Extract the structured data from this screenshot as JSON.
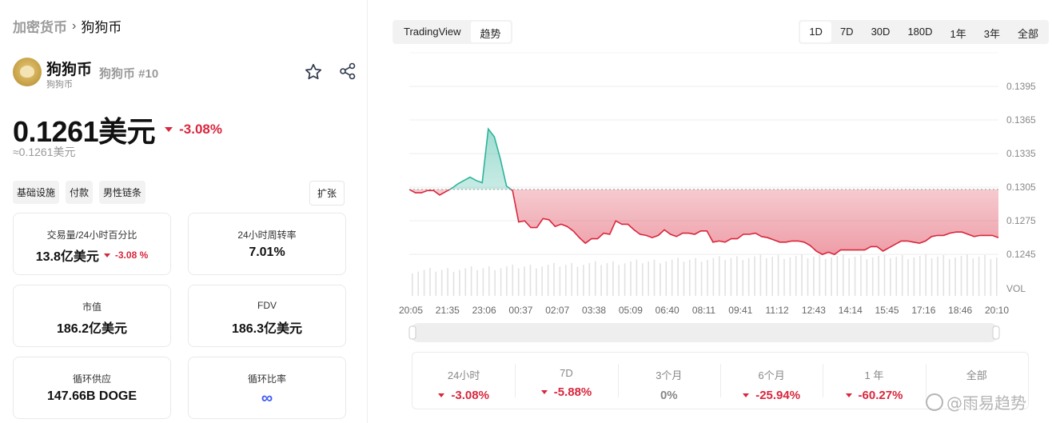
{
  "breadcrumb": {
    "parent": "加密货币",
    "current": "狗狗币"
  },
  "coin": {
    "name": "狗狗币",
    "subname": "狗狗币",
    "rank": "狗狗币 #10"
  },
  "price": {
    "value": "0.1261美元",
    "change": "-3.08%",
    "approx": "≈0.1261美元"
  },
  "tags": [
    "基础设施",
    "付款",
    "男性链条"
  ],
  "expand_label": "扩张",
  "stats": [
    {
      "label": "交易量/24小时百分比",
      "value": "13.8亿美元",
      "sub": "-3.08 %"
    },
    {
      "label": "24小时周转率",
      "value": "7.01%"
    },
    {
      "label": "市值",
      "value": "186.2亿美元"
    },
    {
      "label": "FDV",
      "value": "186.3亿美元"
    },
    {
      "label": "循环供应",
      "value": "147.66B DOGE"
    },
    {
      "label": "循环比率",
      "value": "∞"
    }
  ],
  "view_toggle": [
    "TradingView",
    "趋势"
  ],
  "ranges": [
    "1D",
    "7D",
    "30D",
    "180D",
    "1年",
    "3年",
    "全部"
  ],
  "active_range": "1D",
  "chart_data": {
    "type": "area",
    "baseline": 0.1303,
    "x_ticks": [
      "20:05",
      "21:35",
      "23:06",
      "00:37",
      "02:07",
      "03:38",
      "05:09",
      "06:40",
      "08:11",
      "09:41",
      "11:12",
      "12:43",
      "14:14",
      "15:45",
      "17:16",
      "18:46",
      "20:10"
    ],
    "y_ticks": [
      "0.1395",
      "0.1365",
      "0.1335",
      "0.1305",
      "0.1275",
      "0.1245"
    ],
    "y_label": "VOL",
    "ylim": [
      0.1233,
      0.1415
    ],
    "values": [
      0.1303,
      0.13,
      0.13,
      0.1302,
      0.1302,
      0.1298,
      0.1301,
      0.1304,
      0.1308,
      0.1311,
      0.1314,
      0.1311,
      0.1309,
      0.1357,
      0.135,
      0.133,
      0.1306,
      0.1302,
      0.1274,
      0.1275,
      0.1269,
      0.1269,
      0.1277,
      0.1276,
      0.127,
      0.1272,
      0.127,
      0.1266,
      0.126,
      0.1255,
      0.1259,
      0.1259,
      0.1264,
      0.1263,
      0.1275,
      0.1272,
      0.1272,
      0.1267,
      0.1263,
      0.1262,
      0.126,
      0.1262,
      0.1267,
      0.1263,
      0.1261,
      0.1264,
      0.1264,
      0.1263,
      0.1266,
      0.1266,
      0.1256,
      0.1257,
      0.1256,
      0.1259,
      0.1259,
      0.1263,
      0.1263,
      0.1264,
      0.1261,
      0.126,
      0.1258,
      0.1256,
      0.1256,
      0.1257,
      0.1257,
      0.1256,
      0.1253,
      0.1248,
      0.1245,
      0.1247,
      0.1245,
      0.1249,
      0.1249,
      0.1249,
      0.1249,
      0.1249,
      0.1252,
      0.1252,
      0.1248,
      0.1251,
      0.1254,
      0.1257,
      0.1257,
      0.1256,
      0.1255,
      0.1257,
      0.1261,
      0.1262,
      0.1262,
      0.1264,
      0.1265,
      0.1265,
      0.1263,
      0.1261,
      0.1262,
      0.1262,
      0.1262,
      0.126
    ]
  },
  "performance": [
    {
      "label": "24小时",
      "value": "-3.08%",
      "dir": "down"
    },
    {
      "label": "7D",
      "value": "-5.88%",
      "dir": "down"
    },
    {
      "label": "3个月",
      "value": "0%",
      "dir": "flat"
    },
    {
      "label": "6个月",
      "value": "-25.94%",
      "dir": "down"
    },
    {
      "label": "1 年",
      "value": "-60.27%",
      "dir": "down"
    },
    {
      "label": "全部",
      "value": "",
      "dir": "none"
    }
  ],
  "watermark": "@雨易趋势",
  "colors": {
    "down": "#d9263c",
    "up": "#2bb39a",
    "accent": "#3d5af1"
  }
}
